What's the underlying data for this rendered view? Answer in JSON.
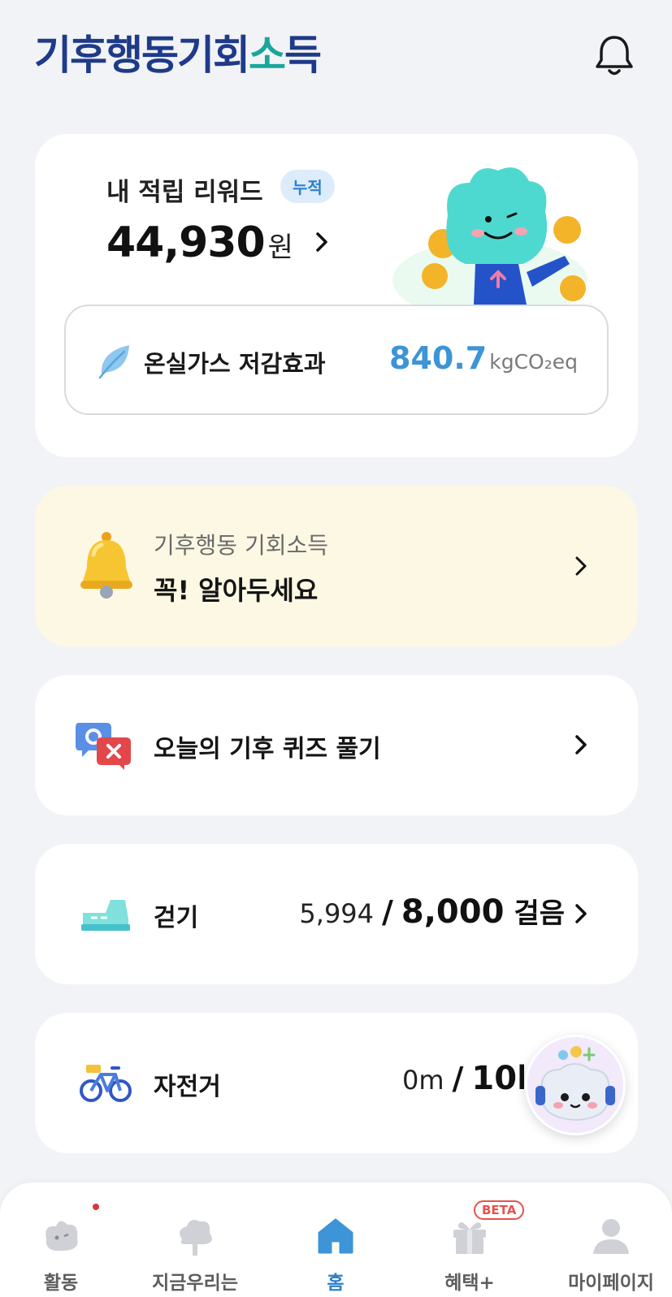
{
  "header": {
    "logo_text_1": "기후행동기회",
    "logo_accent": "소",
    "logo_text_2": "득",
    "bell_icon": "bell-icon"
  },
  "reward": {
    "title": "내 적립 리워드",
    "badge": "누적",
    "amount": "44,930",
    "unit": "원"
  },
  "ghg": {
    "label": "온실가스 저감효과",
    "value": "840.7",
    "unit": "kgCO₂eq"
  },
  "notice": {
    "subtitle": "기후행동 기회소득",
    "title": "꼭! 알아두세요"
  },
  "quiz": {
    "label": "오늘의 기후 퀴즈 풀기"
  },
  "walk": {
    "label": "걷기",
    "current": "5,994",
    "separator": "/",
    "goal": "8,000",
    "unit": "걸음"
  },
  "bike": {
    "label": "자전거",
    "current": "0m",
    "separator": "/",
    "goal": "10k"
  },
  "nav": {
    "items": [
      {
        "label": "활동",
        "icon": "activity-icon"
      },
      {
        "label": "지금우리는",
        "icon": "tree-icon"
      },
      {
        "label": "홈",
        "icon": "home-icon"
      },
      {
        "label": "혜택+",
        "icon": "gift-icon",
        "badge": "BETA"
      },
      {
        "label": "마이페이지",
        "icon": "user-icon"
      }
    ]
  },
  "colors": {
    "brand": "#1e3a8a",
    "accent": "#3d94d6",
    "background": "#f2f3f6",
    "notice_bg": "#fdf8e4"
  }
}
